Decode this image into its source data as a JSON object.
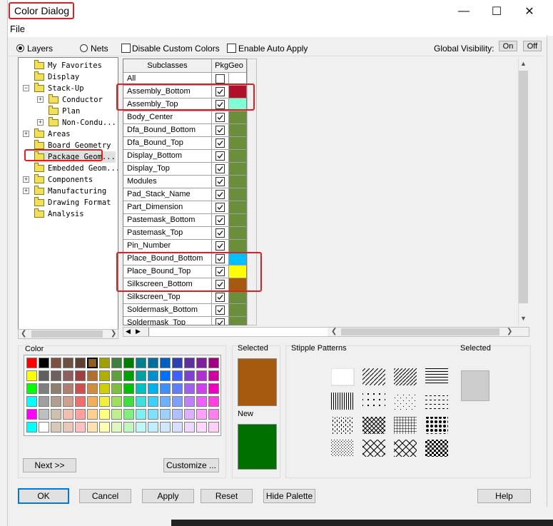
{
  "window": {
    "title": "Color Dialog",
    "minimize": "—",
    "maximize": "☐",
    "close": "✕"
  },
  "menu": {
    "file": "File"
  },
  "toolbar": {
    "layers_label": "Layers",
    "nets_label": "Nets",
    "disable_custom_colors": "Disable Custom Colors",
    "enable_auto_apply": "Enable Auto Apply",
    "global_visibility": "Global Visibility:",
    "on": "On",
    "off": "Off"
  },
  "tree": {
    "items": [
      {
        "label": "My Favorites"
      },
      {
        "label": "Display"
      },
      {
        "label": "Stack-Up"
      },
      {
        "label": "Conductor"
      },
      {
        "label": "Plan"
      },
      {
        "label": "Non-Condu..."
      },
      {
        "label": "Areas"
      },
      {
        "label": "Board Geometry"
      },
      {
        "label": "Package Geom..."
      },
      {
        "label": "Embedded Geom..."
      },
      {
        "label": "Components"
      },
      {
        "label": "Manufacturing"
      },
      {
        "label": "Drawing Format"
      },
      {
        "label": "Analysis"
      }
    ]
  },
  "grid": {
    "col_subclasses": "Subclasses",
    "col_pkggeo": "PkgGeo",
    "rows": [
      {
        "name": "All",
        "color": "#ffffff"
      },
      {
        "name": "Assembly_Bottom",
        "color": "#b0102a"
      },
      {
        "name": "Assembly_Top",
        "color": "#7fffd4"
      },
      {
        "name": "Body_Center",
        "color": "#6b8e3a"
      },
      {
        "name": "Dfa_Bound_Bottom",
        "color": "#6b8e3a"
      },
      {
        "name": "Dfa_Bound_Top",
        "color": "#6b8e3a"
      },
      {
        "name": "Display_Bottom",
        "color": "#6b8e3a"
      },
      {
        "name": "Display_Top",
        "color": "#6b8e3a"
      },
      {
        "name": "Modules",
        "color": "#6b8e3a"
      },
      {
        "name": "Pad_Stack_Name",
        "color": "#6b8e3a"
      },
      {
        "name": "Part_Dimension",
        "color": "#6b8e3a"
      },
      {
        "name": "Pastemask_Bottom",
        "color": "#6b8e3a"
      },
      {
        "name": "Pastemask_Top",
        "color": "#6b8e3a"
      },
      {
        "name": "Pin_Number",
        "color": "#6b8e3a"
      },
      {
        "name": "Place_Bound_Bottom",
        "color": "#00bfff"
      },
      {
        "name": "Place_Bound_Top",
        "color": "#ffff00"
      },
      {
        "name": "Silkscreen_Bottom",
        "color": "#a65a10"
      },
      {
        "name": "Silkscreen_Top",
        "color": "#6b8e3a"
      },
      {
        "name": "Soldermask_Bottom",
        "color": "#6b8e3a"
      },
      {
        "name": "Soldermask_Top",
        "color": "#6b8e3a"
      }
    ]
  },
  "palette": {
    "label": "Color",
    "next_button": "Next >>",
    "customize_button": "Customize ...",
    "colors": [
      [
        "#ff0000",
        "#000000",
        "#7f4f3f",
        "#6f4f3f",
        "#5f3f2f",
        "#8f5f1f",
        "#9f9f00",
        "#3f7f3f",
        "#007f00",
        "#00808f",
        "#006f9f",
        "#005fbf",
        "#2f3faf",
        "#5f2f9f",
        "#7f1f9f",
        "#9f007f"
      ],
      [
        "#ffff00",
        "#5f5f5f",
        "#6f5f5f",
        "#8f5f5f",
        "#9f3f3f",
        "#af6f2f",
        "#afaf00",
        "#5f9f3f",
        "#00a000",
        "#00a0a0",
        "#0090cf",
        "#0070ff",
        "#3f5fff",
        "#7f3fcf",
        "#af2fcf",
        "#cf009f"
      ],
      [
        "#00ff00",
        "#7f7f7f",
        "#8f7f6f",
        "#af7f6f",
        "#cf4f4f",
        "#cf8f3f",
        "#cfcf00",
        "#7fbf3f",
        "#00c000",
        "#00c0c0",
        "#00b0ef",
        "#3f8fff",
        "#5f7fff",
        "#9f5fef",
        "#cf3fef",
        "#ef00bf"
      ],
      [
        "#00ffff",
        "#9f9f9f",
        "#af9f8f",
        "#cf9f8f",
        "#ef6f6f",
        "#efaf5f",
        "#efef3f",
        "#9fdf5f",
        "#3fdf3f",
        "#3fdfdf",
        "#3fcfff",
        "#6fafff",
        "#7f9fff",
        "#bf7fff",
        "#ef5fff",
        "#ff3fdf"
      ],
      [
        "#ff00ff",
        "#bfbfbf",
        "#cfbfaf",
        "#efbfaf",
        "#ff9f9f",
        "#ffcf8f",
        "#ffff7f",
        "#bfef8f",
        "#7fef7f",
        "#7fefef",
        "#7fdfff",
        "#9fcfff",
        "#afbfff",
        "#dfafff",
        "#ff9fff",
        "#ff7fef"
      ],
      [
        "#00ffff",
        "#ffffff",
        "#d8c8b8",
        "#e8c8b8",
        "#ffc0c0",
        "#ffe0b0",
        "#ffffb0",
        "#dff7bf",
        "#bff7bf",
        "#bff7f7",
        "#bfefff",
        "#cfe7ff",
        "#d7dfff",
        "#efd7ff",
        "#ffd7ff",
        "#ffcff7"
      ]
    ],
    "selected_index": [
      0,
      5
    ]
  },
  "preview": {
    "selected_label": "Selected",
    "new_label": "New",
    "selected_color": "#a65a10",
    "new_color": "#007000"
  },
  "stipple": {
    "label": "Stipple Patterns",
    "selected_label": "Selected"
  },
  "buttons": {
    "ok": "OK",
    "cancel": "Cancel",
    "apply": "Apply",
    "reset": "Reset",
    "hide_palette": "Hide Palette",
    "help": "Help"
  }
}
